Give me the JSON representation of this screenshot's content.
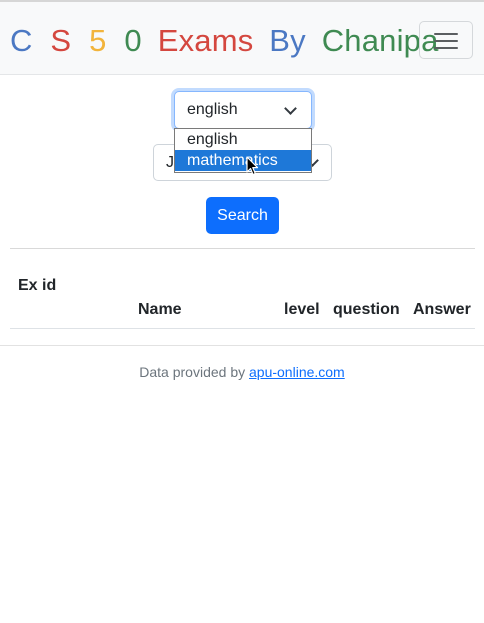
{
  "navbar": {
    "brand_letters": [
      {
        "text": "C",
        "color": "#4b78c3"
      },
      {
        "text": "S",
        "color": "#d4473f"
      },
      {
        "text": "5",
        "color": "#f2b43c"
      },
      {
        "text": "0",
        "color": "#3f8a52"
      },
      {
        "text": "Exams",
        "color": "#d4473f"
      },
      {
        "text": "By",
        "color": "#4b78c3"
      },
      {
        "text": "Chanipa",
        "color": "#3f8a52"
      }
    ],
    "menu_icon": "hamburger-icon"
  },
  "form": {
    "subject_value": "english",
    "subject_options": [
      "english",
      "mathematics"
    ],
    "highlighted_option": "mathematics",
    "level_value_partial": "J",
    "search_label": "Search"
  },
  "table": {
    "headers": [
      "Ex id",
      "Name",
      "level",
      "question",
      "Answer"
    ],
    "rows": []
  },
  "footer": {
    "text": "Data provided by",
    "link_text": "apu-online.com"
  },
  "colors": {
    "primary": "#0d6efd",
    "highlight": "#1e78d8",
    "navbar_bg": "#f8f9fa"
  }
}
